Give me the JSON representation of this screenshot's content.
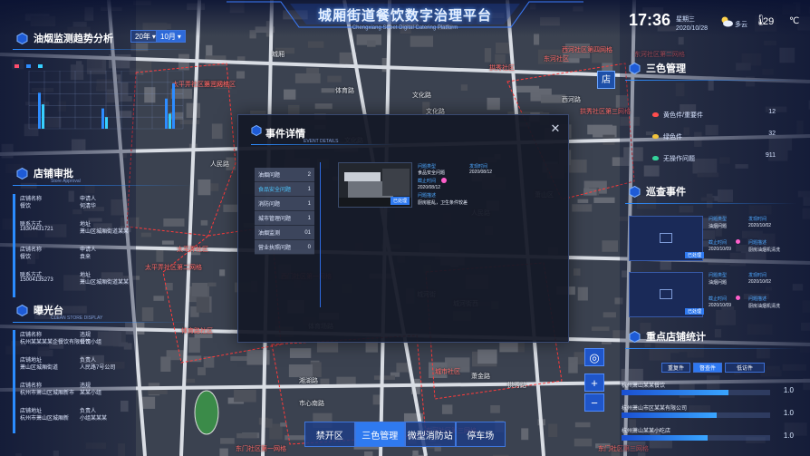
{
  "header": {
    "title": "城厢街道餐饮数字治理平台",
    "subtitle": "Chengxiang Street Digital Catering Platform"
  },
  "clock": {
    "time": "17:36",
    "weekday": "星期三",
    "date": "2020/10/28",
    "weather": "多云",
    "temperature": "29",
    "unit": "℃",
    "icons": {
      "weather": "cloud-sun-icon",
      "thermometer": "thermometer-icon",
      "unit": "celsius-icon"
    }
  },
  "oil": {
    "title": "油烟监测趋势分析",
    "year": "20年",
    "month": "10月",
    "legend": [
      "",
      "",
      ""
    ],
    "legend_colors": [
      "#ff4d6d",
      "#2d8cff",
      "#36d0ff"
    ]
  },
  "shop": {
    "title": "店铺审批",
    "subtitle": "Store Approval",
    "entries": [
      {
        "k1": "店铺名称",
        "v1": "餐饮",
        "k2": "申请人",
        "v2": "何清华",
        "k3": "联系方式",
        "v3": "18304431721",
        "k4": "地址",
        "v4": "萧山区城厢街道某某"
      },
      {
        "k1": "店铺名称",
        "v1": "餐饮",
        "k2": "申请人",
        "v2": "袁来",
        "k3": "联系方式",
        "v3": "15004135273",
        "k4": "地址",
        "v4": "萧山区城厢街道某某"
      }
    ]
  },
  "exposure": {
    "title": "曝光台",
    "subtitle": "CLEAN STORE DISPLAY",
    "entries": [
      {
        "k1": "店铺名称",
        "v1": "杭州某某某某企餐饮有限公司",
        "k2": "违规",
        "v2": "餐饮小组",
        "k3": "店铺地址",
        "v3": "萧山区城厢街道",
        "k4": "负责人",
        "v4": "人民路7号公司"
      },
      {
        "k1": "店铺名称",
        "v1": "杭州市萧山区城厢新市",
        "k2": "违规",
        "v2": "某某小组",
        "k3": "店铺地址",
        "v3": "杭州市萧山区城厢新",
        "k4": "负责人",
        "v4": "小组某某某"
      }
    ]
  },
  "modal": {
    "title": "事件详情",
    "subtitle": "EVENT DETAILS",
    "categories": [
      {
        "label": "油烟问题",
        "count": "2"
      },
      {
        "label": "食品安全问题",
        "count": "1"
      },
      {
        "label": "消防问题",
        "count": "1"
      },
      {
        "label": "城市管理问题",
        "count": "1"
      },
      {
        "label": "油烟监测",
        "count": "01"
      },
      {
        "label": "营业执照问题",
        "count": "0"
      }
    ],
    "event": {
      "tag": "已处理",
      "problem_type_k": "问题类型",
      "problem_type_v": "食品安全问题",
      "report_time_k": "发现时间",
      "report_time_v": "2020/08/12",
      "deadline_k": "截止时间",
      "deadline_v": "2020/08/12",
      "desc_k": "问题描述",
      "desc_v": "厨房脏乱，卫生条件较差"
    }
  },
  "color_mgmt": {
    "title": "三色管理",
    "store_icon_text": "店",
    "rows": [
      {
        "label": "黄色件/重要件",
        "value": "12",
        "color": "#ff4d4d"
      },
      {
        "label": "绿色件",
        "value": "32",
        "color": "#f2c33b"
      },
      {
        "label": "无操作问题",
        "value": "911",
        "color": "#34d39b"
      }
    ]
  },
  "patrol": {
    "title": "巡查事件",
    "items": [
      {
        "tag": "已处理",
        "k1": "问题类型",
        "v1": "油烟问题",
        "k2": "发现时间",
        "v2": "2020/10/02",
        "k3": "截止时间",
        "v3": "2020/10/09",
        "k4": "问题描述",
        "v4": "厨房油烟机清洗"
      },
      {
        "tag": "已处理",
        "k1": "问题类型",
        "v1": "油烟问题",
        "k2": "发现时间",
        "v2": "2020/10/02",
        "k3": "截止时间",
        "v3": "2020/10/09",
        "k4": "问题描述",
        "v4": "厨房油烟机清洗"
      }
    ]
  },
  "key_stats": {
    "title": "重点店铺统计",
    "tabs": [
      "重复件",
      "督查件",
      "低访件"
    ],
    "rows": [
      {
        "name": "杭州萧山某某餐饮",
        "value": "1.0",
        "pct": 0.72
      },
      {
        "name": "杭州萧山市区某某有限公司",
        "value": "1.0",
        "pct": 0.64
      },
      {
        "name": "杭州萧山某某小吃店",
        "value": "1.0",
        "pct": 0.58
      }
    ]
  },
  "map_controls": {
    "locate": "◎",
    "zoom_in": "+",
    "zoom_out": "−"
  },
  "bottom_nav": [
    "禁开区",
    "三色管理",
    "微型消防站",
    "停车场"
  ],
  "map_labels": [
    "西河路社区",
    "体育路",
    "文化路",
    "人民路",
    "城厢",
    "太平弄社区第三网格",
    "西河路",
    "文化路",
    "拱秀社区",
    "拱秀社区第三网格",
    "人民路",
    "萧山区",
    "太平弄社区",
    "东河社区",
    "西门社区第一网格",
    "城河街",
    "城河街西",
    "东河社区第三网格",
    "东河社区第二网格",
    "文化路",
    "西河社区第四网格",
    "湘湖路",
    "萧金路",
    "城市社区",
    "市心南路",
    "东门社区第一网格",
    "东门社区第三网格",
    "体育路社区",
    "体育场路",
    "拱秀路",
    "太平弄社区第二网格"
  ]
}
